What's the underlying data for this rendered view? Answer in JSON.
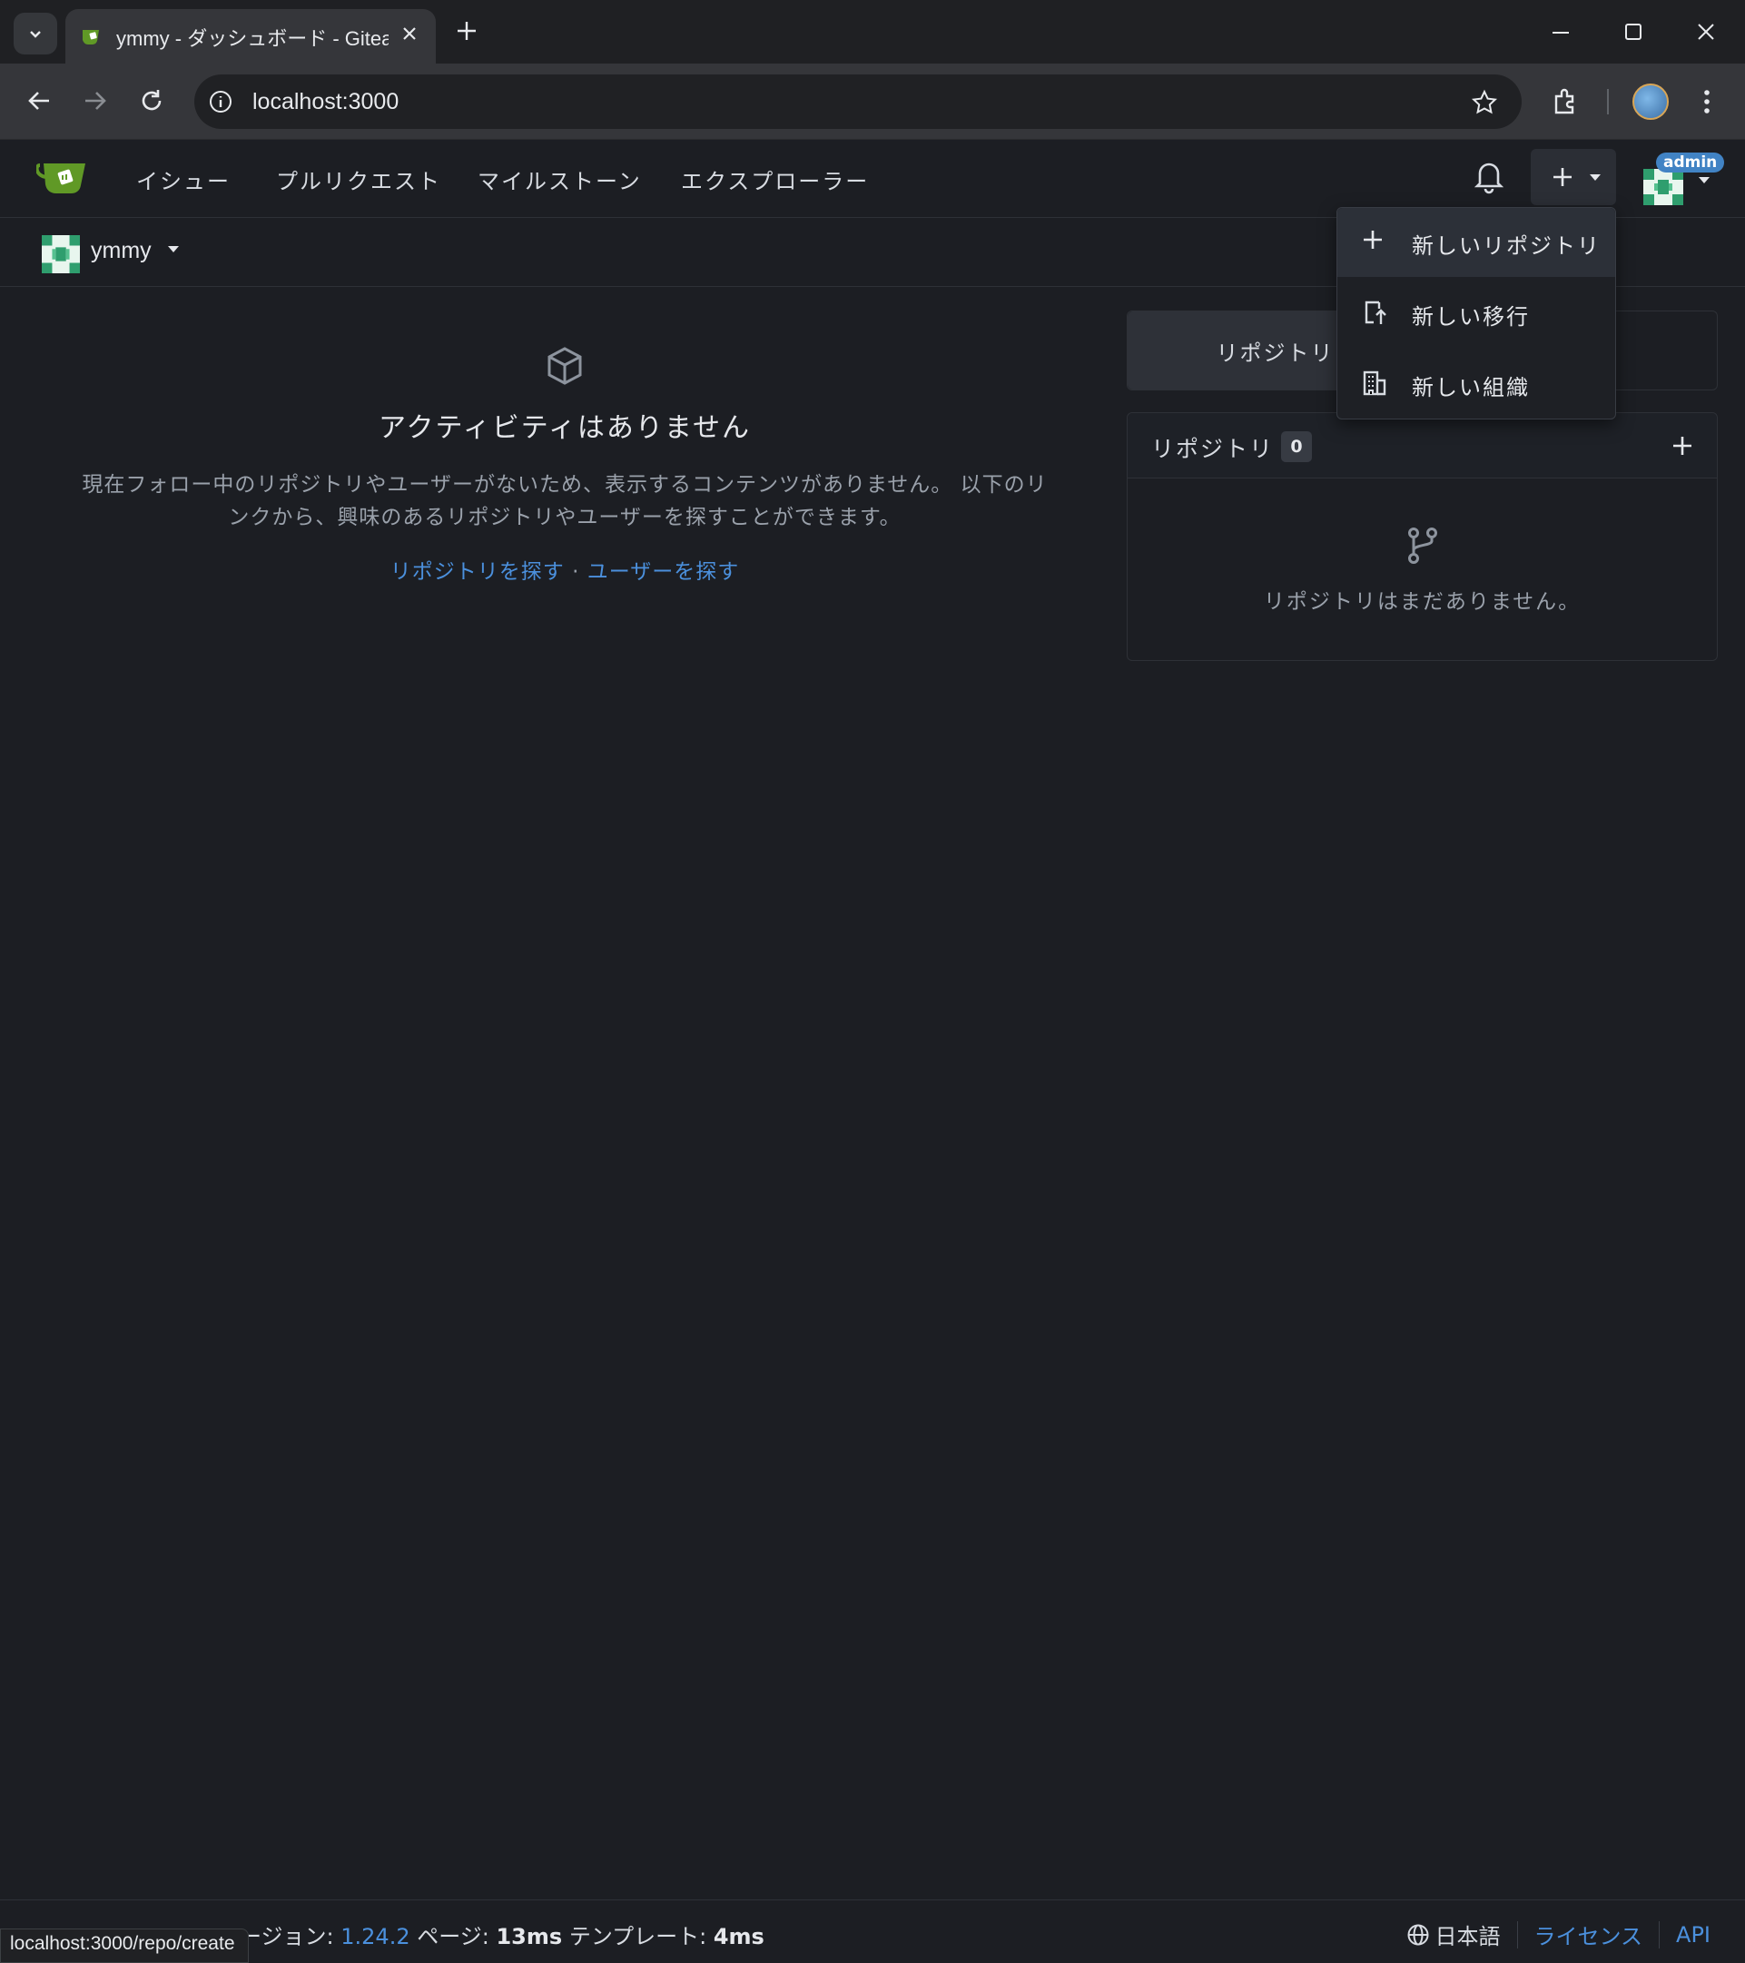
{
  "browser": {
    "tab_title": "ymmy - ダッシュボード - Gitea: Git",
    "url": "localhost:3000",
    "status_url": "localhost:3000/repo/create"
  },
  "nav": {
    "items": [
      "イシュー",
      "プルリクエスト",
      "マイルストーン",
      "エクスプローラー"
    ],
    "admin_badge": "admin"
  },
  "context": {
    "user": "ymmy"
  },
  "feed": {
    "title": "アクティビティはありません",
    "description": "現在フォロー中のリポジトリやユーザーがないため、表示するコンテンツがありません。 以下のリンクから、興味のあるリポジトリやユーザーを探すことができます。",
    "link_repos": "リポジトリを探す",
    "link_sep": "·",
    "link_users": "ユーザーを探す"
  },
  "sidebar": {
    "tab_repos": "リポジトリ",
    "repo_title": "リポジトリ",
    "repo_count": "0",
    "empty_text": "リポジトリはまだありません。"
  },
  "create_menu": {
    "items": [
      "新しいリポジトリ",
      "新しい移行",
      "新しい組織"
    ]
  },
  "footer": {
    "version_label": "ージョン:",
    "version": "1.24.2",
    "page_label": "ページ:",
    "page_time": "13ms",
    "template_label": "テンプレート:",
    "template_time": "4ms",
    "language": "日本語",
    "license": "ライセンス",
    "api": "API"
  },
  "colors": {
    "background": "#1c1e23",
    "accent": "#4183c4",
    "link": "#4b90dd",
    "brand_green": "#609926"
  }
}
